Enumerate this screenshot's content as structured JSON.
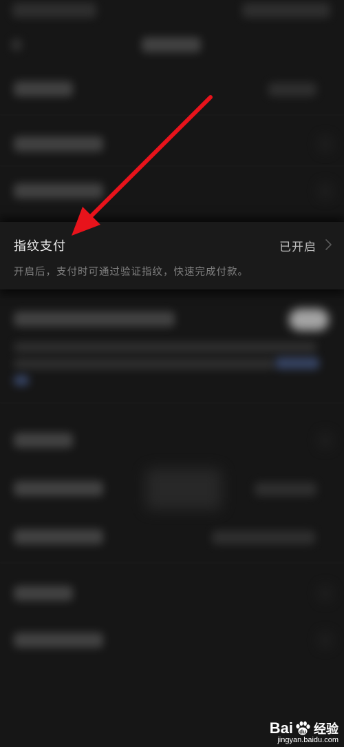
{
  "setting": {
    "title": "指纹支付",
    "status": "已开启",
    "description": "开启后，支付时可通过验证指纹，快速完成付款。"
  },
  "watermark": {
    "logo_prefix": "Bai",
    "logo_suffix": "经验",
    "url": "jingyan.baidu.com"
  },
  "colors": {
    "background": "#161616",
    "arrow": "#e8131b"
  }
}
